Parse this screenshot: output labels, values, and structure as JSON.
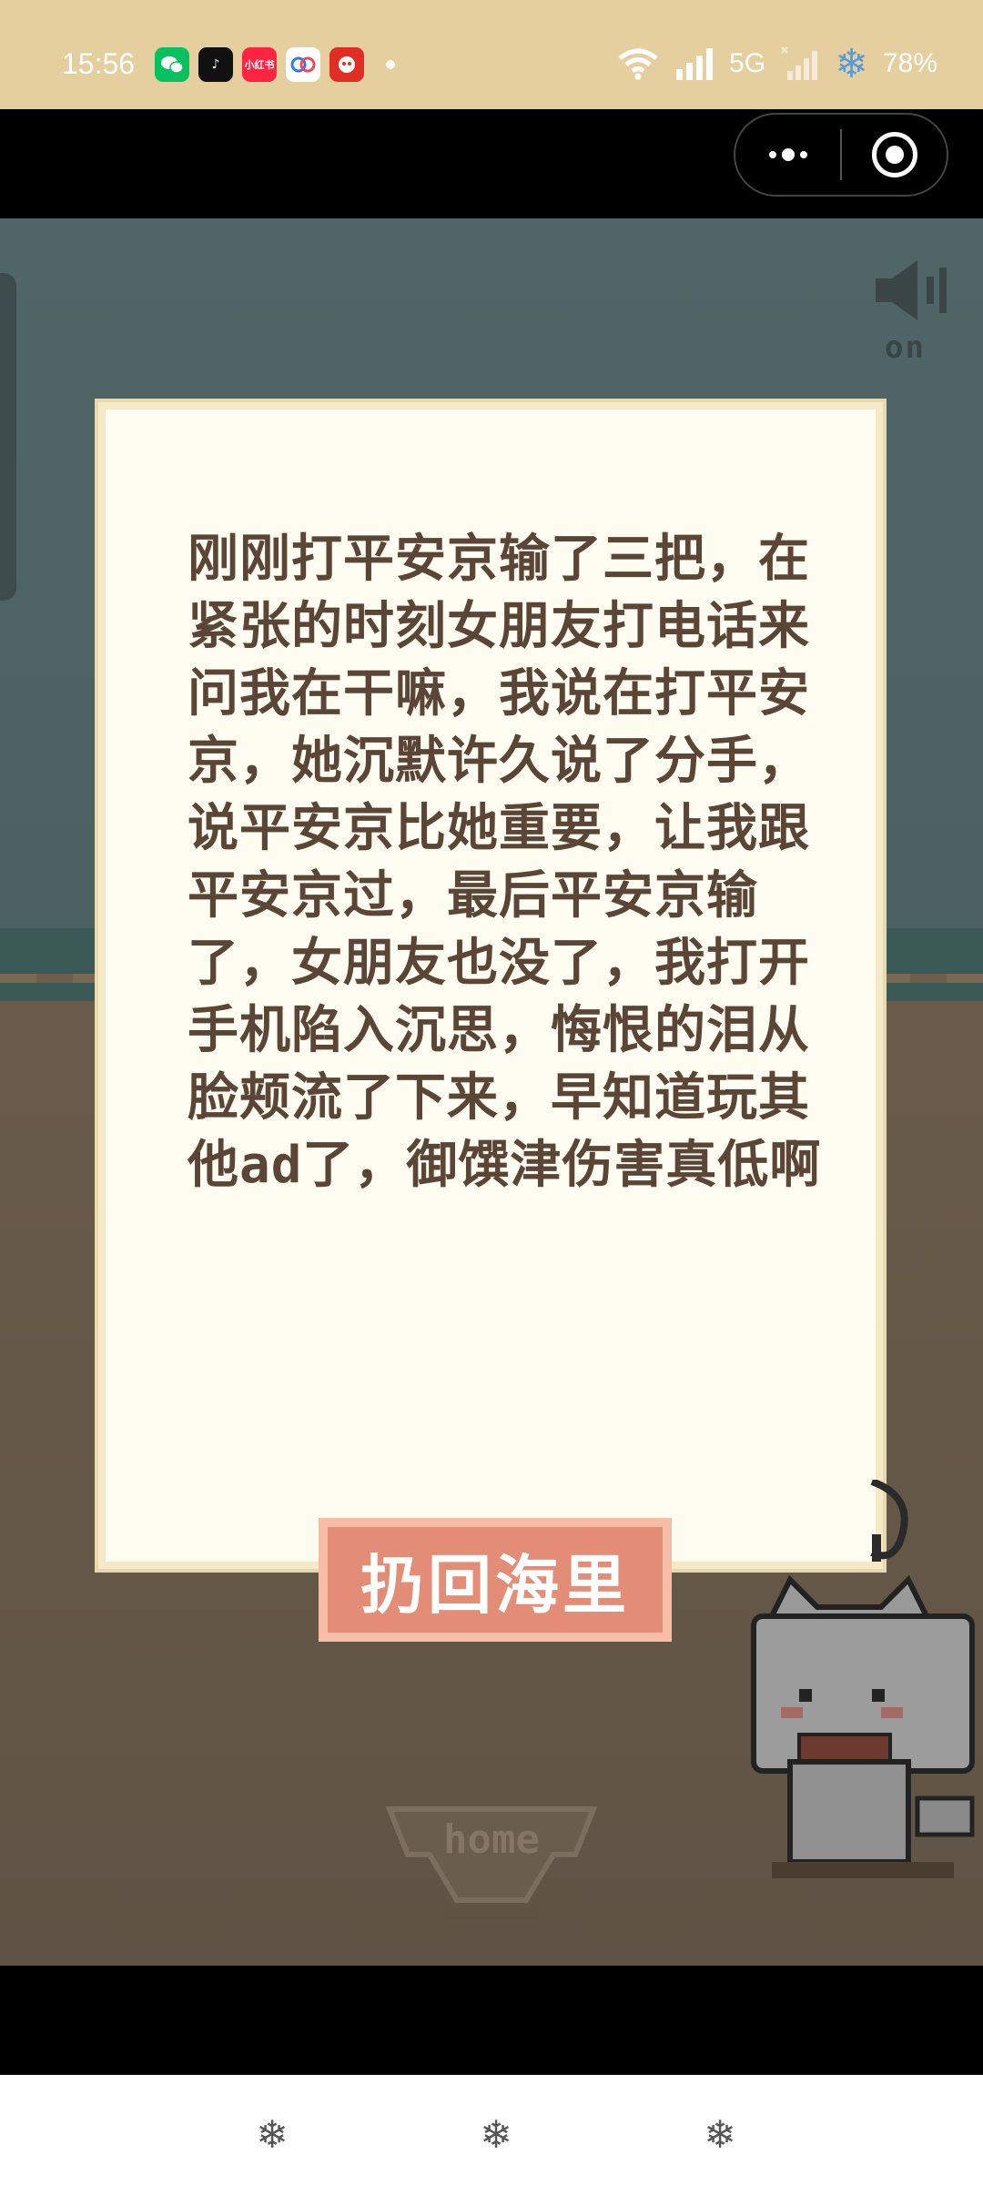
{
  "status_bar": {
    "time": "15:56",
    "apps": [
      {
        "name": "wechat-icon",
        "color": "#07c160",
        "label": ""
      },
      {
        "name": "tiktok-icon",
        "color": "#111111",
        "label": "♪"
      },
      {
        "name": "xiaohongshu-icon",
        "color": "#ff2442",
        "label": "小红书"
      },
      {
        "name": "baidu-netdisk-icon",
        "color": "#ffffff",
        "label": ""
      },
      {
        "name": "pinduoduo-icon",
        "color": "#e02e24",
        "label": ""
      }
    ],
    "network": "5G",
    "battery": "78%"
  },
  "mini_program_bar": {
    "more_icon": "more-dots-icon",
    "close_icon": "target-close-icon"
  },
  "game": {
    "sound_label": "on",
    "bottle_message": "刚刚打平安京输了三把，在紧张的时刻女朋友打电话来问我在干嘛，我说在打平安京，她沉默许久说了分手，说平安京比她重要，让我跟平安京过，最后平安京输了，女朋友也没了，我打开手机陷入沉思，悔恨的泪从脸颊流了下来，早知道玩其他ad了，御馔津伤害真低啊",
    "throw_button": "扔回海里",
    "home_button": "home"
  },
  "colors": {
    "status_bar_bg": "#e6cf9f",
    "card_bg": "#fffdf1",
    "card_text": "#5a4536",
    "button_bg": "#e38d76",
    "sea": "#4c6262",
    "sand": "#5f5445"
  }
}
